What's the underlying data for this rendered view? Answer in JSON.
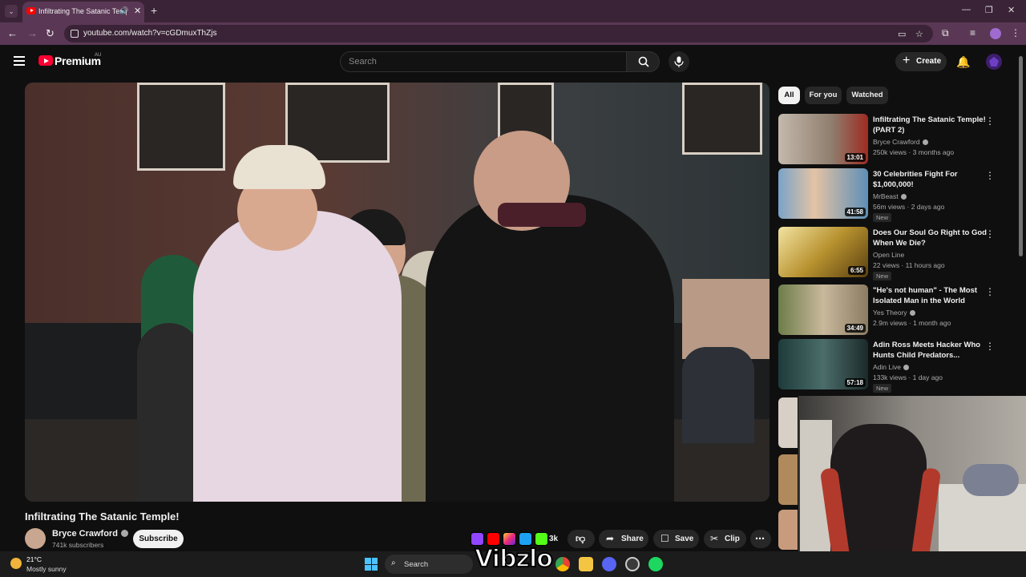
{
  "browser": {
    "tab_title": "Infiltrating The Satanic Temp",
    "tab_dropdown": "⌄",
    "newtab": "+",
    "url": "youtube.com/watch?v=cGDmuxThZjs"
  },
  "header": {
    "brand": "Premium",
    "country": "AU",
    "search_placeholder": "Search",
    "create_label": "Create"
  },
  "video": {
    "title": "Infiltrating The Satanic Temple!",
    "channel": "Bryce Crawford",
    "subscribers": "741k subscribers",
    "subscribe_label": "Subscribe",
    "likes": "3k",
    "share_label": "Share",
    "save_label": "Save",
    "clip_label": "Clip"
  },
  "chips": [
    "All",
    "For you",
    "Watched"
  ],
  "recommendations": [
    {
      "title": "Infiltrating The Satanic Temple! (PART 2)",
      "channel": "Bryce Crawford",
      "meta": "250k views · 3 months ago",
      "duration": "13:01",
      "badge": ""
    },
    {
      "title": "30 Celebrities Fight For $1,000,000!",
      "channel": "MrBeast",
      "meta": "56m views · 2 days ago",
      "duration": "41:58",
      "badge": "New"
    },
    {
      "title": "Does Our Soul Go Right to God When We Die?",
      "channel": "Open Line",
      "meta": "22 views · 11 hours ago",
      "duration": "6:55",
      "badge": "New"
    },
    {
      "title": "\"He's not human\" - The Most Isolated Man in the World",
      "channel": "Yes Theory",
      "meta": "2.9m views · 1 month ago",
      "duration": "34:49",
      "badge": ""
    },
    {
      "title": "Adin Ross Meets Hacker Who Hunts Child Predators...",
      "channel": "Adin Live",
      "meta": "133k views · 1 day ago",
      "duration": "57:18",
      "badge": "New"
    }
  ],
  "taskbar": {
    "temperature": "21°C",
    "weather": "Mostly sunny",
    "search_label": "Search"
  },
  "overlay": {
    "watermark": "Vibzlo"
  },
  "colors": {
    "youtube_red": "#ff0033",
    "browser_frame": "#5a3855"
  }
}
